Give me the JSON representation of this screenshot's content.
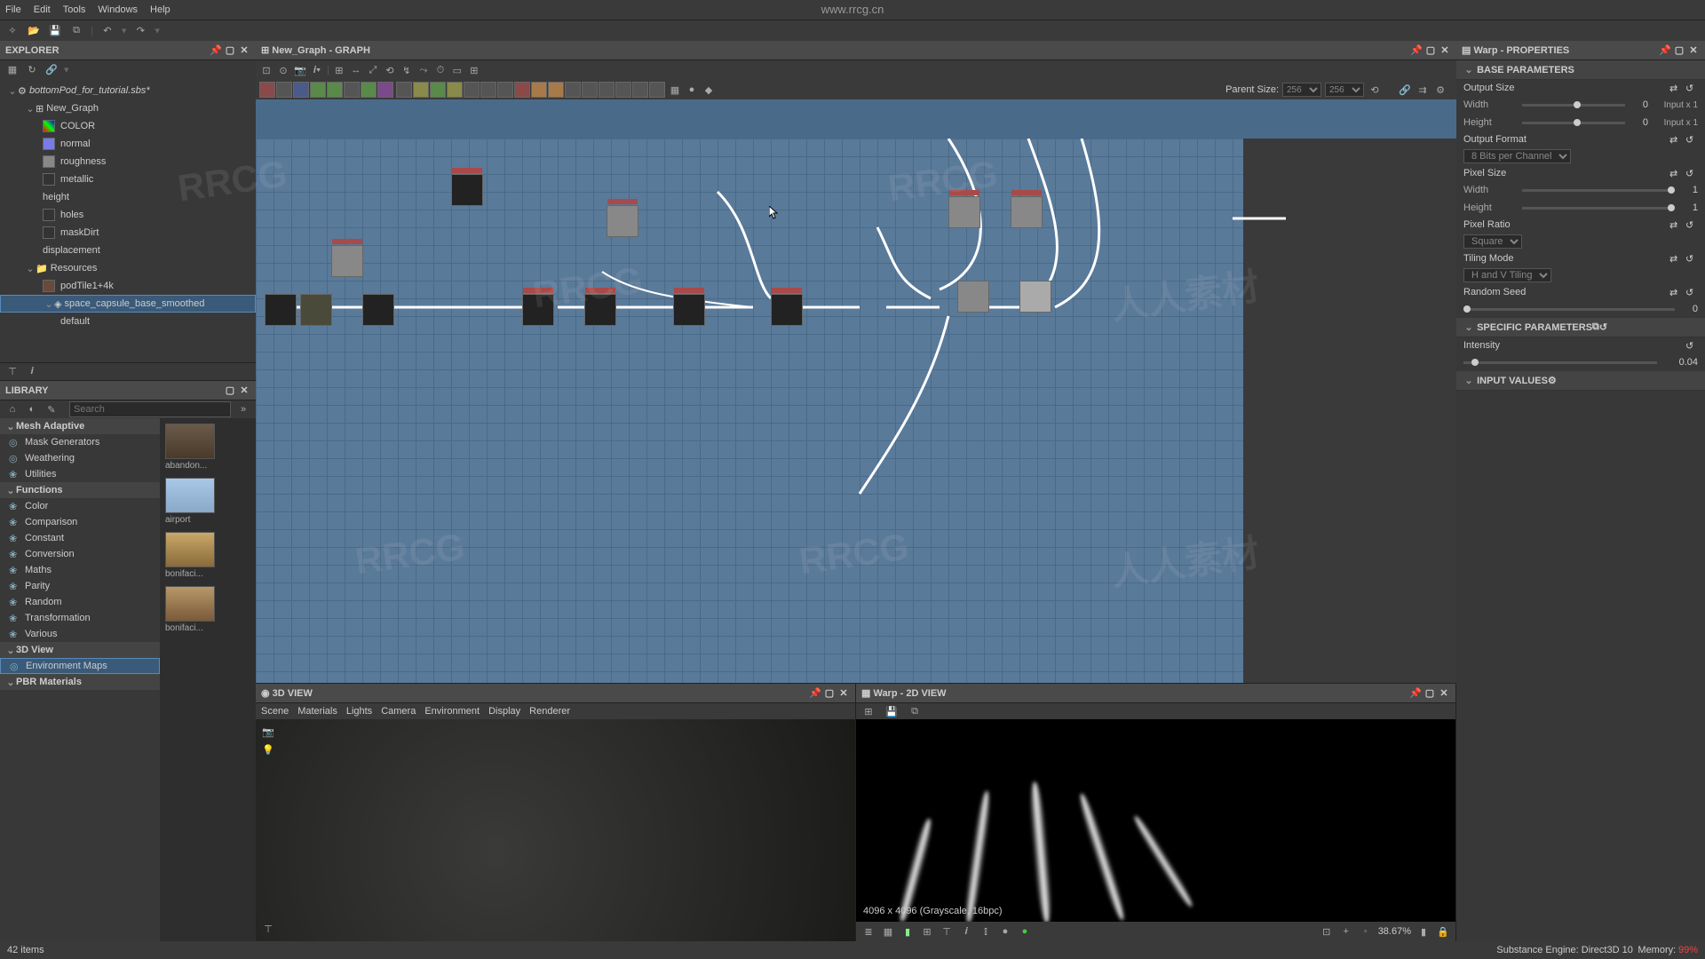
{
  "menubar": {
    "items": [
      "File",
      "Edit",
      "Tools",
      "Windows",
      "Help"
    ],
    "url": "www.rrcg.cn"
  },
  "explorer": {
    "title": "EXPLORER",
    "root": "bottomPod_for_tutorial.sbs*",
    "graph": "New_Graph",
    "outputs": [
      "COLOR",
      "normal",
      "roughness",
      "metallic",
      "height",
      "holes",
      "maskDirt",
      "displacement"
    ],
    "resources_label": "Resources",
    "resources": [
      "podTile1+4k",
      "space_capsule_base_smoothed",
      "default"
    ],
    "selected": "space_capsule_base_smoothed"
  },
  "library": {
    "title": "LIBRARY",
    "search_placeholder": "Search",
    "cats": [
      {
        "label": "Mesh Adaptive",
        "hdr": true
      },
      {
        "label": "Mask Generators"
      },
      {
        "label": "Weathering"
      },
      {
        "label": "Utilities"
      },
      {
        "label": "Functions",
        "hdr": true
      },
      {
        "label": "Color"
      },
      {
        "label": "Comparison"
      },
      {
        "label": "Constant"
      },
      {
        "label": "Conversion"
      },
      {
        "label": "Maths"
      },
      {
        "label": "Parity"
      },
      {
        "label": "Random"
      },
      {
        "label": "Transformation"
      },
      {
        "label": "Various"
      },
      {
        "label": "3D View",
        "hdr": true
      },
      {
        "label": "Environment Maps",
        "sel": true
      },
      {
        "label": "PBR Materials",
        "hdr": true
      }
    ],
    "thumbs": [
      "abandon...",
      "airport",
      "bonifaci...",
      "bonifaci..."
    ],
    "count": "42 items"
  },
  "graph": {
    "title": "New_Graph - GRAPH",
    "parent_size_label": "Parent Size:",
    "parent_size_values": [
      "256",
      "256"
    ]
  },
  "view3d": {
    "title": "3D VIEW",
    "menu": [
      "Scene",
      "Materials",
      "Lights",
      "Camera",
      "Environment",
      "Display",
      "Renderer"
    ]
  },
  "view2d": {
    "title": "Warp - 2D VIEW",
    "info": "4096 x 4096 (Grayscale, 16bpc)",
    "zoom": "38.67%"
  },
  "properties": {
    "title": "Warp - PROPERTIES",
    "sections": {
      "base": "BASE PARAMETERS",
      "specific": "SPECIFIC PARAMETERS",
      "input": "INPUT VALUES"
    },
    "output_size": {
      "label": "Output Size",
      "width_label": "Width",
      "width_val": "0",
      "width_unit": "Input x 1",
      "height_label": "Height",
      "height_val": "0",
      "height_unit": "Input x 1"
    },
    "output_format": {
      "label": "Output Format",
      "value": "8 Bits per Channel"
    },
    "pixel_size": {
      "label": "Pixel Size",
      "width_label": "Width",
      "width_val": "1",
      "height_label": "Height",
      "height_val": "1"
    },
    "pixel_ratio": {
      "label": "Pixel Ratio",
      "value": "Square"
    },
    "tiling": {
      "label": "Tiling Mode",
      "value": "H and V Tiling"
    },
    "random_seed": {
      "label": "Random Seed",
      "value": "0"
    },
    "intensity": {
      "label": "Intensity",
      "value": "0.04"
    }
  },
  "status": {
    "engine": "Substance Engine: Direct3D 10",
    "memory": "Memory:",
    "pct": "99%"
  }
}
